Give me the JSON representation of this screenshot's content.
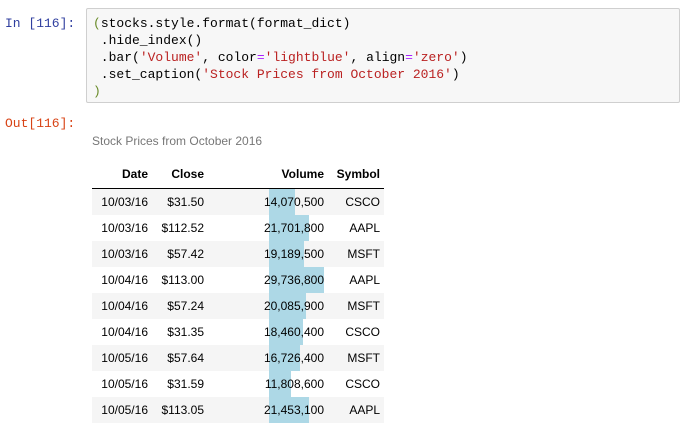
{
  "input_prompt": "In [116]:",
  "output_prompt": "Out[116]:",
  "code": {
    "line1": {
      "paren": "(",
      "text": "stocks.style.format(format_dict)"
    },
    "line2": {
      "text": " .hide_index()"
    },
    "line3": {
      "pre": " .bar(",
      "s1": "'Volume'",
      "mid1": ", color",
      "eq1": "=",
      "s2": "'lightblue'",
      "mid2": ", align",
      "eq2": "=",
      "s3": "'zero'",
      "post": ")"
    },
    "line4": {
      "pre": " .set_caption(",
      "s1": "'Stock Prices from October 2016'",
      "post": ")"
    },
    "line5": {
      "paren": ")"
    }
  },
  "colors": {
    "bar": "#add8e6",
    "input_prompt": "#303f9f",
    "output_prompt": "#d84315"
  },
  "table": {
    "caption": "Stock Prices from October 2016",
    "headers": {
      "date": "Date",
      "close": "Close",
      "volume": "Volume",
      "symbol": "Symbol"
    },
    "volume_bar_max": 29736800,
    "rows": [
      {
        "date": "10/03/16",
        "close": "$31.50",
        "volume": "14,070,500",
        "volume_value": 14070500,
        "symbol": "CSCO"
      },
      {
        "date": "10/03/16",
        "close": "$112.52",
        "volume": "21,701,800",
        "volume_value": 21701800,
        "symbol": "AAPL"
      },
      {
        "date": "10/03/16",
        "close": "$57.42",
        "volume": "19,189,500",
        "volume_value": 19189500,
        "symbol": "MSFT"
      },
      {
        "date": "10/04/16",
        "close": "$113.00",
        "volume": "29,736,800",
        "volume_value": 29736800,
        "symbol": "AAPL"
      },
      {
        "date": "10/04/16",
        "close": "$57.24",
        "volume": "20,085,900",
        "volume_value": 20085900,
        "symbol": "MSFT"
      },
      {
        "date": "10/04/16",
        "close": "$31.35",
        "volume": "18,460,400",
        "volume_value": 18460400,
        "symbol": "CSCO"
      },
      {
        "date": "10/05/16",
        "close": "$57.64",
        "volume": "16,726,400",
        "volume_value": 16726400,
        "symbol": "MSFT"
      },
      {
        "date": "10/05/16",
        "close": "$31.59",
        "volume": "11,808,600",
        "volume_value": 11808600,
        "symbol": "CSCO"
      },
      {
        "date": "10/05/16",
        "close": "$113.05",
        "volume": "21,453,100",
        "volume_value": 21453100,
        "symbol": "AAPL"
      }
    ]
  }
}
